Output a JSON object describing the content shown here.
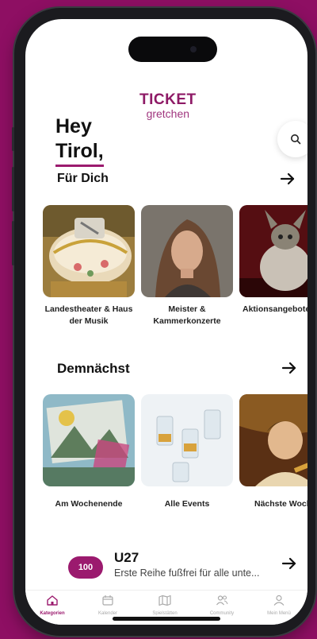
{
  "brand": {
    "line1": "TICKET",
    "line2": "gretchen",
    "accent": "#9b1a6e",
    "background": "#8e0f63"
  },
  "header": {
    "greeting_line1": "Hey",
    "greeting_line2": "Tirol,",
    "search_icon": "search-icon"
  },
  "sections": {
    "fuer_dich": {
      "title": "Für Dich",
      "cards": [
        {
          "label": "Landestheater & Haus der Musik"
        },
        {
          "label": "Meister & Kammerkonzerte"
        },
        {
          "label": "Aktionsangebote"
        }
      ]
    },
    "demnaechst": {
      "title": "Demnächst",
      "cards": [
        {
          "label": "Am Wochenende"
        },
        {
          "label": "Alle Events"
        },
        {
          "label": "Nächste Woche"
        }
      ]
    }
  },
  "u27": {
    "badge": "100",
    "title": "U27",
    "subtitle": "Erste Reihe fußfrei für alle unte..."
  },
  "tabbar": {
    "items": [
      {
        "label": "Kategorien",
        "icon": "home-icon",
        "active": true
      },
      {
        "label": "Kalender",
        "icon": "calendar-icon",
        "active": false
      },
      {
        "label": "Spielstätten",
        "icon": "map-icon",
        "active": false
      },
      {
        "label": "Community",
        "icon": "people-icon",
        "active": false
      },
      {
        "label": "Mein Menü",
        "icon": "user-icon",
        "active": false
      }
    ]
  }
}
